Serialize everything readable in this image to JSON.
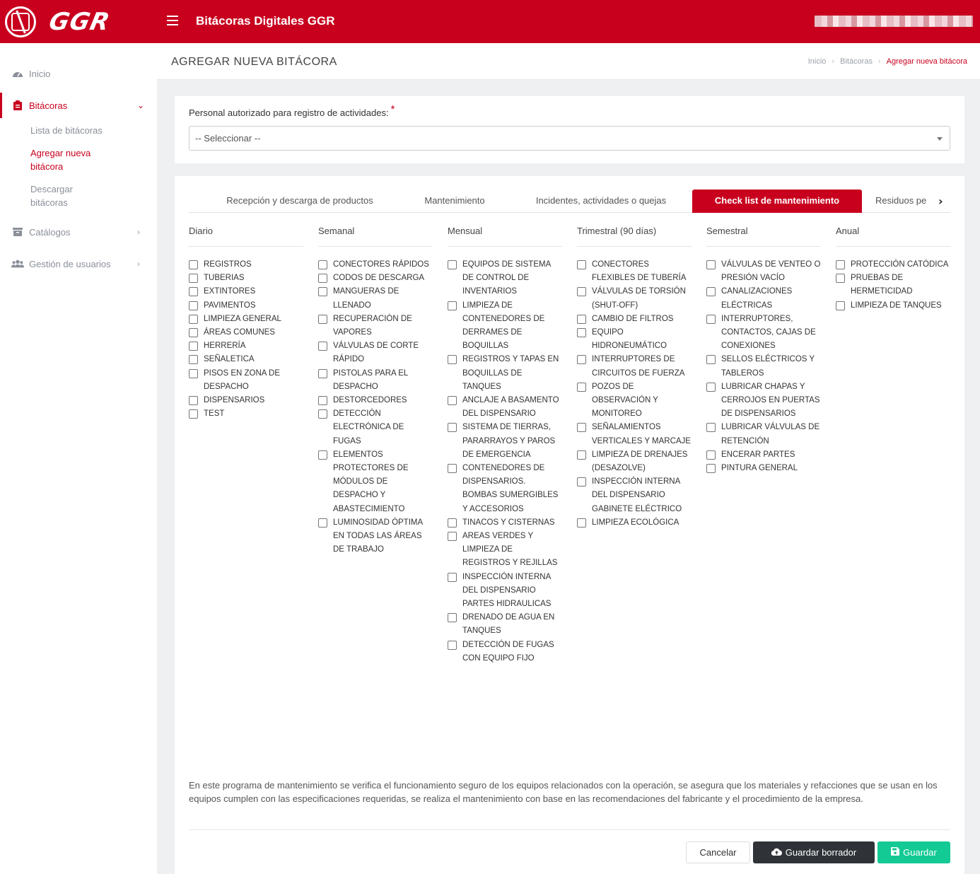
{
  "header": {
    "logo_text": "GGR",
    "app_title": "Bitácoras Digitales GGR"
  },
  "sidebar": {
    "inicio": "Inicio",
    "bitacoras": "Bitácoras",
    "sub": {
      "lista": "Lista de bitácoras",
      "agregar": "Agregar nueva bitácora",
      "descargar": "Descargar bitácoras"
    },
    "catalogos": "Catálogos",
    "usuarios": "Gestión de usuarios"
  },
  "page": {
    "title": "AGREGAR NUEVA BITÁCORA",
    "breadcrumb": [
      "Inicio",
      "Bitácoras",
      "Agregar nueva bitácora"
    ]
  },
  "form": {
    "personal_label": "Personal autorizado para registro de actividades:",
    "required_mark": "*",
    "select_value": "-- Seleccionar --"
  },
  "tabs": [
    "Recepción y descarga de productos",
    "Mantenimiento",
    "Incidentes, actividades o quejas",
    "Check list de mantenimiento",
    "Residuos pe"
  ],
  "active_tab": 3,
  "columns": [
    {
      "title": "Diario",
      "items": [
        "REGISTROS",
        "TUBERIAS",
        "EXTINTORES",
        "PAVIMENTOS",
        "LIMPIEZA GENERAL",
        "ÁREAS COMUNES",
        "HERRERÍA",
        "SEÑALETICA",
        "PISOS EN ZONA DE DESPACHO",
        "DISPENSARIOS",
        "TEST"
      ]
    },
    {
      "title": "Semanal",
      "items": [
        "CONECTORES RÁPIDOS",
        "CODOS DE DESCARGA",
        "MANGUERAS DE LLENADO",
        "RECUPERACIÓN DE VAPORES",
        "VÁLVULAS DE CORTE RÁPIDO",
        "PISTOLAS PARA EL DESPACHO",
        "DESTORCEDORES",
        "DETECCIÓN ELECTRÓNICA DE FUGAS",
        "ELEMENTOS PROTECTORES DE MÓDULOS DE DESPACHO Y ABASTECIMIENTO",
        "LUMINOSIDAD ÓPTIMA EN TODAS LAS ÁREAS DE TRABAJO"
      ]
    },
    {
      "title": "Mensual",
      "items": [
        "EQUIPOS DE SISTEMA DE CONTROL DE INVENTARIOS",
        "LIMPIEZA DE CONTENEDORES DE DERRAMES DE BOQUILLAS",
        "REGISTROS Y TAPAS EN BOQUILLAS DE TANQUES",
        "ANCLAJE A BASAMENTO DEL DISPENSARIO",
        "SISTEMA DE TIERRAS, PARARRAYOS Y PAROS DE EMERGENCIA",
        "CONTENEDORES DE DISPENSARIOS. BOMBAS SUMERGIBLES Y ACCESORIOS",
        "TINACOS Y CISTERNAS",
        "AREAS VERDES Y LIMPIEZA DE REGISTROS Y REJILLAS",
        "INSPECCIÓN INTERNA DEL DISPENSARIO PARTES HIDRAULICAS",
        "DRENADO DE AGUA EN TANQUES",
        "DETECCIÓN DE FUGAS CON EQUIPO FIJO"
      ]
    },
    {
      "title": "Trimestral (90 días)",
      "items": [
        "CONECTORES FLEXIBLES DE TUBERÍA",
        "VÁLVULAS DE TORSIÓN (SHUT-OFF)",
        "CAMBIO DE FILTROS",
        "EQUIPO HIDRONEUMÁTICO",
        "INTERRUPTORES DE CIRCUITOS DE FUERZA",
        "POZOS DE OBSERVACIÓN Y MONITOREO",
        "SEÑALAMIENTOS VERTICALES Y MARCAJE",
        "LIMPIEZA DE DRENAJES (DESAZOLVE)",
        "INSPECCIÓN INTERNA DEL DISPENSARIO GABINETE ELÉCTRICO",
        "LIMPIEZA ECOLÓGICA"
      ]
    },
    {
      "title": "Semestral",
      "items": [
        "VÁLVULAS DE VENTEO O PRESIÓN VACÍO",
        "CANALIZACIONES ELÉCTRICAS",
        "INTERRUPTORES, CONTACTOS, CAJAS DE CONEXIONES",
        "SELLOS ELÉCTRICOS Y TABLEROS",
        "LUBRICAR CHAPAS Y CERROJOS EN PUERTAS DE DISPENSARIOS",
        "LUBRICAR VÁLVULAS DE RETENCIÓN",
        "ENCERAR PARTES",
        "PINTURA GENERAL"
      ]
    },
    {
      "title": "Anual",
      "items": [
        "PROTECCIÓN CATÓDICA",
        "PRUEBAS DE HERMETICIDAD",
        "LIMPIEZA DE TANQUES"
      ]
    }
  ],
  "description": "En este programa de mantenimiento se verifica el funcionamiento seguro de los equipos relacionados con la operación, se asegura que los materiales y refacciones que se usan en los equipos cumplen con las especificaciones requeridas, se realiza el mantenimiento con base en las recomendaciones del fabricante y el procedimiento de la empresa.",
  "buttons": {
    "cancel": "Cancelar",
    "draft": "Guardar borrador",
    "save": "Guardar"
  },
  "colors": {
    "brand_red": "#c8001e",
    "dark_button": "#2f3338",
    "save_green": "#13c994"
  }
}
